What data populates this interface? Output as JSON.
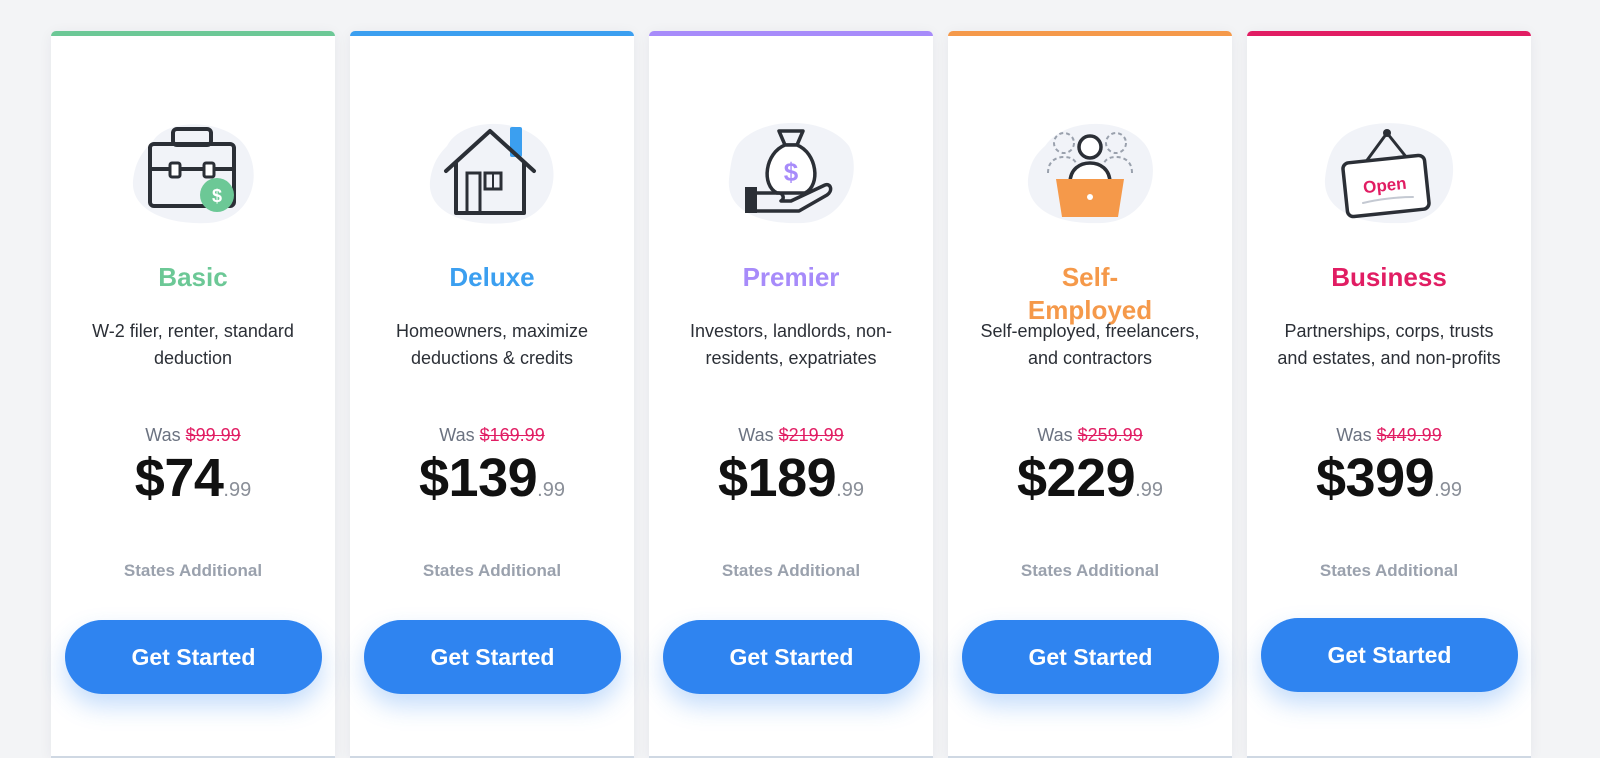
{
  "plans": [
    {
      "name": "Basic",
      "color": "#6cc896",
      "icon": "briefcase-dollar-icon",
      "description": "W-2 filer, renter, standard deduction",
      "was_label": "Was",
      "old_price": "$99.99",
      "price_main": "$74",
      "price_cents": ".99",
      "note": "States Additional",
      "cta": "Get Started"
    },
    {
      "name": "Deluxe",
      "color": "#3b9ff0",
      "icon": "house-icon",
      "description": "Homeowners, maximize deductions & credits",
      "was_label": "Was",
      "old_price": "$169.99",
      "price_main": "$139",
      "price_cents": ".99",
      "note": "States Additional",
      "cta": "Get Started"
    },
    {
      "name": "Premier",
      "color": "#a78bfa",
      "icon": "money-bag-hand-icon",
      "description": "Investors, landlords, non-residents, expatriates",
      "was_label": "Was",
      "old_price": "$219.99",
      "price_main": "$189",
      "price_cents": ".99",
      "note": "States Additional",
      "cta": "Get Started"
    },
    {
      "name": "Self-Employed",
      "color": "#f5994a",
      "icon": "person-laptop-icon",
      "description": "Self-employed, freelancers, and contractors",
      "was_label": "Was",
      "old_price": "$259.99",
      "price_main": "$229",
      "price_cents": ".99",
      "note": "States Additional",
      "cta": "Get Started"
    },
    {
      "name": "Business",
      "color": "#e11d63",
      "icon": "open-sign-icon",
      "sign_text": "Open",
      "description": "Partnerships, corps, trusts and estates, and non-profits",
      "was_label": "Was",
      "old_price": "$449.99",
      "price_main": "$399",
      "price_cents": ".99",
      "note": "States Additional",
      "cta": "Get Started"
    }
  ],
  "theme": {
    "button_color": "#2f84f0",
    "strike_color": "#e11d63"
  }
}
